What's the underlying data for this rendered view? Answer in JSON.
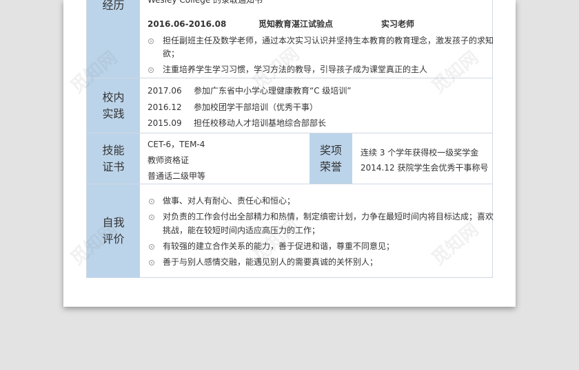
{
  "watermark": "觅知网",
  "experience": {
    "label": "经历",
    "top_line": "Wesley College 的录取通知书",
    "entry": {
      "date": "2016.06-2016.08",
      "place": "觅知教育湛江试验点",
      "role": "实习老师"
    },
    "bullets": [
      "担任副班主任及数学老师，通过本次实习认识并坚持生本教育的教育理念，激发孩子的求知",
      "欲；",
      "注重培养学生学习习惯，学习方法的教导，引导孩子成为课堂真正的主人"
    ]
  },
  "practice": {
    "label": "校内\n实践",
    "items": [
      {
        "date": "2017.06",
        "text": "参加广东省中小学心理健康教育“C 级培训”"
      },
      {
        "date": "2016.12",
        "text": "参加校团学干部培训（优秀干事）"
      },
      {
        "date": "2015.09",
        "text": "担任校移动人才培训基地综合部部长"
      }
    ]
  },
  "skills": {
    "label": "技能\n证书",
    "items": [
      "CET-6，TEM-4",
      "教师资格证",
      "普通话二级甲等"
    ]
  },
  "awards": {
    "label": "奖项\n荣誉",
    "items": [
      "连续 3 个学年获得校一级奖学金",
      "2014.12 获院学生会优秀干事称号"
    ]
  },
  "self_eval": {
    "label": "自我\n评价",
    "lines": [
      "做事、对人有耐心、责任心和恒心；",
      "对负责的工作会付出全部精力和热情，制定缜密计划，力争在最短时间内将目标达成；喜欢",
      "挑战，能在较短时间内适应高压力的工作；",
      "有较强的建立合作关系的能力，善于促进和谐，尊重不同意见；",
      "善于与别人感情交融，能遇见别人的需要真诚的关怀别人；"
    ]
  }
}
